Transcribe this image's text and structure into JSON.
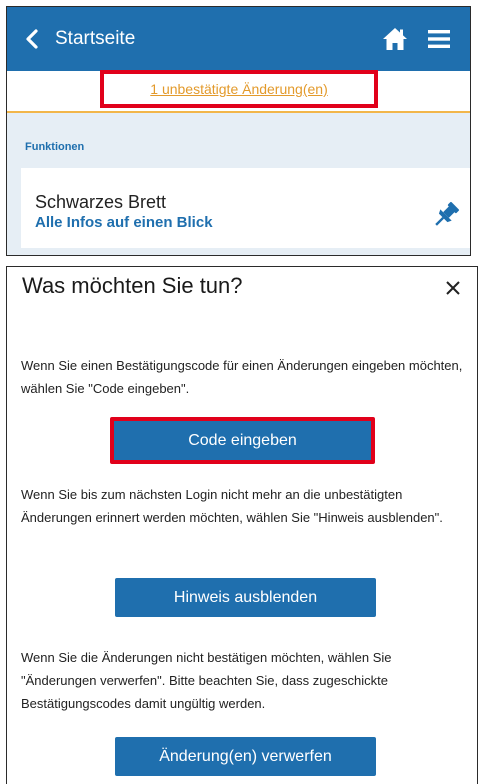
{
  "header": {
    "back_label": "Startseite",
    "icons": [
      "chevron-left-icon",
      "home-icon",
      "hamburger-menu-icon"
    ],
    "color": "#1f6fae"
  },
  "notice": {
    "link_text": "1 unbestätigte Änderung(en)",
    "highlight_color": "#e1001a"
  },
  "section": {
    "label": "Funktionen"
  },
  "card": {
    "title": "Schwarzes Brett",
    "subtitle": "Alle Infos auf einen Blick",
    "icon": "pin-icon"
  },
  "dialog": {
    "title": "Was möchten Sie tun?",
    "close_icon": "close-icon",
    "text_code": "Wenn Sie einen Bestätigungscode für einen Änderungen eingeben möchten, wählen Sie \"Code eingeben\".",
    "button_code": "Code eingeben",
    "text_hide": "Wenn Sie bis zum nächsten Login nicht mehr an die unbestätigten Änderungen erinnert werden möchten, wählen Sie \"Hinweis ausblenden\".",
    "button_hide": "Hinweis ausblenden",
    "text_discard": "Wenn Sie die Änderungen nicht bestätigen möchten, wählen Sie \"Änderungen verwerfen\". Bitte beachten Sie, dass zugeschickte Bestätigungscodes damit ungültig werden.",
    "button_discard": "Änderung(en) verwerfen"
  },
  "colors": {
    "primary": "#1f6fae",
    "accent_orange": "#e39a2b",
    "highlight_red": "#e1001a"
  }
}
